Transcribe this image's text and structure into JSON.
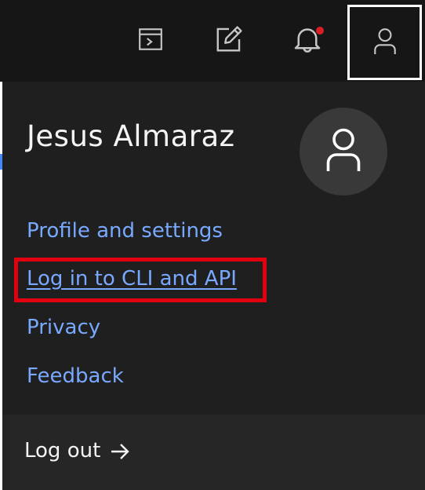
{
  "header": {
    "icons": [
      "cloud-shell-icon",
      "edit-icon",
      "notification-icon",
      "user-icon"
    ],
    "notification_dot_color": "#da1e28"
  },
  "profile_panel": {
    "user_name": "Jesus Almaraz",
    "avatar_icon": "user-avatar-icon",
    "links": {
      "profile": "Profile and settings",
      "cli": "Log in to CLI and API",
      "privacy": "Privacy",
      "feedback": "Feedback"
    },
    "logout_label": "Log out",
    "logout_icon": "arrow-right-icon",
    "highlight_color": "#e00010",
    "link_color": "#78a9ff"
  }
}
